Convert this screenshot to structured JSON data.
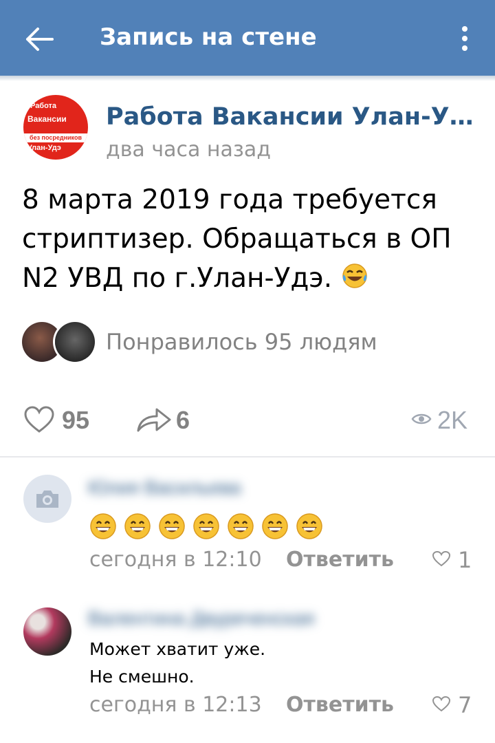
{
  "header": {
    "title": "Запись на стене"
  },
  "post": {
    "group_name": "Работа Вакансии Улан-У…",
    "time": "два часа назад",
    "avatar_logo": {
      "line1": "Работа",
      "line2": "Вакансии",
      "stripe": "без посредников",
      "line3": "Улан-Удэ"
    },
    "text": "8 марта 2019 года требуется стриптизер. Обращаться в ОП N2 УВД по г.Улан-Удэ.",
    "liked_by": "Понравилось 95 людям",
    "likes": "95",
    "shares": "6",
    "views": "2K"
  },
  "comments": [
    {
      "author": "Юлия Васильева",
      "time": "сегодня в 12:10",
      "reply": "Ответить",
      "likes": "1"
    },
    {
      "author": "Валентина Двуреченская",
      "text_line1": "Может хватит уже.",
      "text_line2": "Не смешно.",
      "time": "сегодня в 12:13",
      "reply": "Ответить",
      "likes": "7"
    }
  ],
  "colors": {
    "header": "#5181b8",
    "link": "#2a5885",
    "muted": "#939393"
  }
}
